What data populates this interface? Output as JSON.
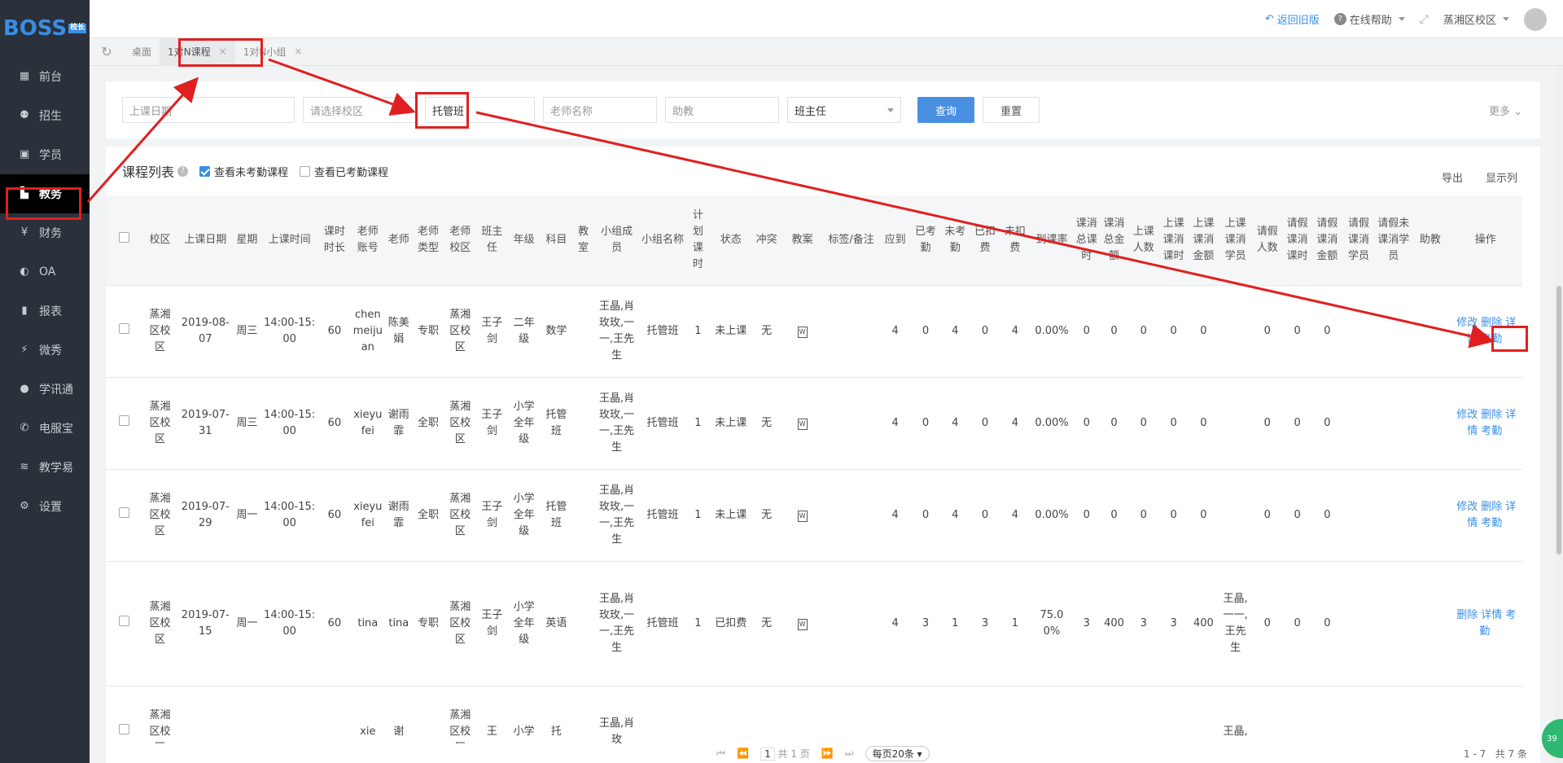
{
  "logo": {
    "text": "BOSS",
    "badge": "校长"
  },
  "sidebar": {
    "items": [
      {
        "label": "前台",
        "icon": "calendar-icon"
      },
      {
        "label": "招生",
        "icon": "user-plus-icon"
      },
      {
        "label": "学员",
        "icon": "id-card-icon"
      },
      {
        "label": "教务",
        "icon": "book-icon",
        "active": true
      },
      {
        "label": "财务",
        "icon": "yen-icon"
      },
      {
        "label": "OA",
        "icon": "toggle-icon"
      },
      {
        "label": "报表",
        "icon": "bar-chart-icon"
      },
      {
        "label": "微秀",
        "icon": "show-icon"
      },
      {
        "label": "学讯通",
        "icon": "location-icon"
      },
      {
        "label": "电服宝",
        "icon": "phone-icon"
      },
      {
        "label": "教学易",
        "icon": "stack-icon"
      },
      {
        "label": "设置",
        "icon": "gear-icon"
      }
    ]
  },
  "topbar": {
    "back": "返回旧版",
    "help": "在线帮助",
    "campus": "蒸湘区校区"
  },
  "tabs": [
    {
      "label": "桌面",
      "closable": false
    },
    {
      "label": "1对N课程",
      "closable": true,
      "active": true
    },
    {
      "label": "1对N小组",
      "closable": true
    }
  ],
  "filter": {
    "date_placeholder": "上课日期",
    "campus_placeholder": "请选择校区",
    "group_value": "托管班",
    "teacher_placeholder": "老师名称",
    "assistant_placeholder": "助教",
    "head_teacher": "班主任",
    "search": "查询",
    "reset": "重置",
    "more": "更多"
  },
  "list": {
    "title": "课程列表",
    "show_unchecked": "查看未考勤课程",
    "show_checked": "查看已考勤课程",
    "export": "导出",
    "columns_btn": "显示列"
  },
  "table": {
    "headers": [
      "校区",
      "上课日期",
      "星期",
      "上课时间",
      "课时时长",
      "老师账号",
      "老师",
      "老师类型",
      "老师校区",
      "班主任",
      "年级",
      "科目",
      "教室",
      "小组成员",
      "小组名称",
      "计划课时",
      "状态",
      "冲突",
      "教案",
      "标签/备注",
      "应到",
      "已考勤",
      "未考勤",
      "已扣费",
      "未扣费",
      "到课率",
      "课消总课时",
      "课消总金额",
      "上课人数",
      "上课课消课时",
      "上课课消金额",
      "上课课消学员",
      "请假人数",
      "请假课消课时",
      "请假课消金额",
      "请假课消学员",
      "请假未课消学员",
      "助教",
      "操作"
    ],
    "rows": [
      [
        "蒸湘区校区",
        "2019-08-07",
        "周三",
        "14:00-15:00",
        "60",
        "chenmeijuan",
        "陈美娟",
        "专职",
        "蒸湘区校区",
        "王子剑",
        "二年级",
        "数学",
        "",
        "王晶,肖玫玫,一一,王先生",
        "托管班",
        "1",
        "未上课",
        "无",
        "doc",
        "",
        "4",
        "0",
        "4",
        "0",
        "4",
        "0.00%",
        "0",
        "0",
        "0",
        "0",
        "0",
        "",
        "0",
        "0",
        "0",
        "",
        "",
        "",
        "修改 删除 详情 考勤"
      ],
      [
        "蒸湘区校区",
        "2019-07-31",
        "周三",
        "14:00-15:00",
        "60",
        "xieyufei",
        "谢雨霏",
        "全职",
        "蒸湘区校区",
        "王子剑",
        "小学全年级",
        "托管班",
        "",
        "王晶,肖玫玫,一一,王先生",
        "托管班",
        "1",
        "未上课",
        "无",
        "doc",
        "",
        "4",
        "0",
        "4",
        "0",
        "4",
        "0.00%",
        "0",
        "0",
        "0",
        "0",
        "0",
        "",
        "0",
        "0",
        "0",
        "",
        "",
        "",
        "修改 删除 详情 考勤"
      ],
      [
        "蒸湘区校区",
        "2019-07-29",
        "周一",
        "14:00-15:00",
        "60",
        "xieyufei",
        "谢雨霏",
        "全职",
        "蒸湘区校区",
        "王子剑",
        "小学全年级",
        "托管班",
        "",
        "王晶,肖玫玫,一一,王先生",
        "托管班",
        "1",
        "未上课",
        "无",
        "doc",
        "",
        "4",
        "0",
        "4",
        "0",
        "4",
        "0.00%",
        "0",
        "0",
        "0",
        "0",
        "0",
        "",
        "0",
        "0",
        "0",
        "",
        "",
        "",
        "修改 删除 详情 考勤"
      ],
      [
        "蒸湘区校区",
        "2019-07-15",
        "周一",
        "14:00-15:00",
        "60",
        "tina",
        "tina",
        "专职",
        "蒸湘区校区",
        "王子剑",
        "小学全年级",
        "英语",
        "",
        "王晶,肖玫玫,一一,王先生",
        "托管班",
        "1",
        "已扣费",
        "无",
        "doc",
        "",
        "4",
        "3",
        "1",
        "3",
        "1",
        "75.00%",
        "3",
        "400",
        "3",
        "3",
        "400",
        "王晶,一一,王先生",
        "0",
        "0",
        "0",
        "",
        "",
        "",
        "删除 详情 考勤"
      ],
      [
        "蒸湘区校区",
        "",
        "",
        "",
        "",
        "xie",
        "谢",
        "",
        "蒸湘区校区",
        "王",
        "小学",
        "托",
        "",
        "王晶,肖玫",
        "",
        "",
        "",
        "",
        "",
        "",
        "",
        "",
        "",
        "",
        "",
        "",
        "",
        "",
        "",
        "",
        "",
        "王晶,",
        "",
        "",
        "",
        "",
        "",
        "",
        ""
      ]
    ]
  },
  "pager": {
    "page_info": "共 1 页",
    "current": "1",
    "page_size": "每页20条",
    "range": "1 - 7",
    "total": "共 7 条"
  },
  "float_badge": "39"
}
